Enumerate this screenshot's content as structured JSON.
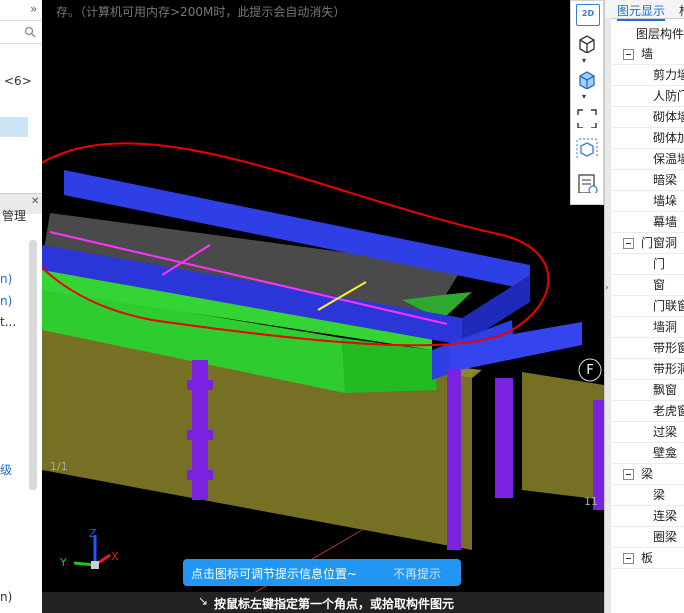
{
  "left_panel": {
    "arrow": "»",
    "page_suffix": "<6>",
    "tab_label": "管理",
    "row_items": [
      "n)",
      "n)",
      "t...",
      "级",
      "n)"
    ]
  },
  "viewport": {
    "hint_text": "存。（计算机可用内存>200M时，此提示会自动消失）",
    "axis_labels": {
      "z": "Z",
      "x": "X",
      "y": "Y"
    },
    "axis_markers": [
      "F",
      "1/1",
      "11"
    ],
    "tip": {
      "message": "点击图标可调节提示信息位置~",
      "dismiss": "不再提示"
    },
    "status": "按鼠标左键指定第一个角点，或拾取构件图元"
  },
  "toolbar": {
    "buttons": [
      "2d-view-icon",
      "3d-wireframe-icon",
      "3d-solid-icon",
      "fullscreen-icon",
      "3d-orbit-icon",
      "display-settings-icon"
    ],
    "label_2d": "2D"
  },
  "right_panel": {
    "tabs": [
      "图元显示",
      "构"
    ],
    "header": "图层构件",
    "tree": [
      {
        "label": "墙",
        "group": true
      },
      {
        "label": "剪力墙",
        "group": false
      },
      {
        "label": "人防门",
        "group": false
      },
      {
        "label": "砌体墙",
        "group": false
      },
      {
        "label": "砌体加",
        "group": false
      },
      {
        "label": "保温墙",
        "group": false
      },
      {
        "label": "暗梁",
        "group": false
      },
      {
        "label": "墙垛",
        "group": false
      },
      {
        "label": "幕墙",
        "group": false
      },
      {
        "label": "门窗洞",
        "group": true
      },
      {
        "label": "门",
        "group": false
      },
      {
        "label": "窗",
        "group": false
      },
      {
        "label": "门联窗",
        "group": false
      },
      {
        "label": "墙洞",
        "group": false
      },
      {
        "label": "带形窗",
        "group": false
      },
      {
        "label": "带形洞",
        "group": false
      },
      {
        "label": "飘窗",
        "group": false
      },
      {
        "label": "老虎窗",
        "group": false
      },
      {
        "label": "过梁",
        "group": false
      },
      {
        "label": "壁龛",
        "group": false
      },
      {
        "label": "梁",
        "group": true
      },
      {
        "label": "梁",
        "group": false
      },
      {
        "label": "连梁",
        "group": false
      },
      {
        "label": "圈梁",
        "group": false
      },
      {
        "label": "板",
        "group": true
      }
    ]
  }
}
